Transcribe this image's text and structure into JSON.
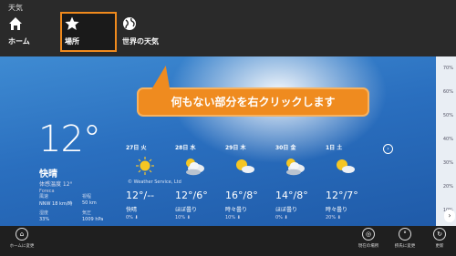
{
  "app": {
    "title": "天気"
  },
  "nav": [
    {
      "label": "ホーム",
      "icon": "home-icon"
    },
    {
      "label": "場所",
      "icon": "star-icon"
    },
    {
      "label": "世界の天気",
      "icon": "globe-icon"
    }
  ],
  "callout": {
    "text": "何もない部分を右クリックします",
    "color": "#ef8b1f"
  },
  "current": {
    "temp": "12°",
    "condition": "快晴",
    "feels_like": "体感温度 12°",
    "provider": "Foreca",
    "details": [
      {
        "label": "風速",
        "value": "NNW 18 km/時"
      },
      {
        "label": "視程",
        "value": "50 km"
      },
      {
        "label": "湿度",
        "value": "33%"
      },
      {
        "label": "気圧",
        "value": "1009 hPa"
      }
    ]
  },
  "forecast": [
    {
      "day": "27日 火",
      "icon": "sun-icon",
      "hilo": "12°/--",
      "desc": "快晴",
      "precip": "0% ⬇"
    },
    {
      "day": "28日 水",
      "icon": "partly-cloudy-icon",
      "hilo": "12°/6°",
      "desc": "ほぼ曇り",
      "precip": "10% ⬇"
    },
    {
      "day": "29日 木",
      "icon": "sun-cloud-icon",
      "hilo": "16°/8°",
      "desc": "時々曇り",
      "precip": "10% ⬇"
    },
    {
      "day": "30日 金",
      "icon": "partly-cloudy-icon",
      "hilo": "14°/8°",
      "desc": "ほぼ曇り",
      "precip": "0% ⬇"
    },
    {
      "day": "1日 土",
      "icon": "sun-cloud-icon",
      "hilo": "12°/7°",
      "desc": "時々曇り",
      "precip": "20% ⬇"
    }
  ],
  "credit": "© Weather Service, Ltd",
  "scale_ticks": [
    "70%",
    "60%",
    "50%",
    "40%",
    "30%",
    "20%",
    "10%"
  ],
  "bottom_bar": {
    "home_change": "ホームに変更",
    "current_location": "現在の場所",
    "unit_change": "摂氏に変更",
    "refresh": "更新"
  }
}
